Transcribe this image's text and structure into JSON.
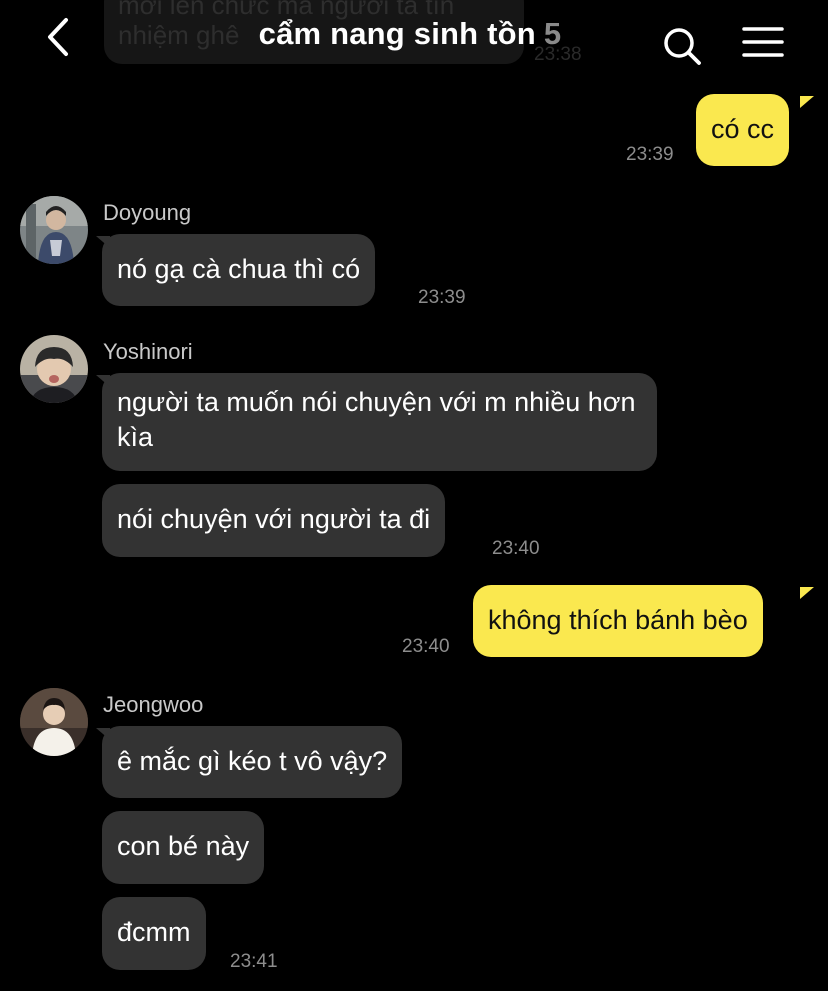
{
  "header": {
    "title": "cẩm nang sinh tồn",
    "member_count": "5",
    "ghost_message": "mới lên chức mà người ta tín nhiệm ghê",
    "ghost_time": "23:38"
  },
  "messages": [
    {
      "id": "m1",
      "direction": "outgoing",
      "text": "có cc",
      "time": "23:39"
    },
    {
      "id": "m2",
      "direction": "incoming",
      "sender": "Doyoung",
      "text": "nó gạ cà chua thì có",
      "time": "23:39"
    },
    {
      "id": "m3",
      "direction": "incoming",
      "sender": "Yoshinori",
      "text": "người ta muốn nói chuyện với m nhiều hơn kìa"
    },
    {
      "id": "m4",
      "direction": "incoming",
      "sender": "Yoshinori",
      "text": "nói chuyện với người ta đi",
      "time": "23:40"
    },
    {
      "id": "m5",
      "direction": "outgoing",
      "text": "không thích bánh bèo",
      "time": "23:40"
    },
    {
      "id": "m6",
      "direction": "incoming",
      "sender": "Jeongwoo",
      "text": "ê mắc gì kéo t vô vậy?"
    },
    {
      "id": "m7",
      "direction": "incoming",
      "sender": "Jeongwoo",
      "text": "con bé này"
    },
    {
      "id": "m8",
      "direction": "incoming",
      "sender": "Jeongwoo",
      "text": "đcmm",
      "time": "23:41"
    }
  ],
  "icons": {
    "back": "chevron-left-icon",
    "search": "search-icon",
    "menu": "hamburger-menu-icon"
  },
  "colors": {
    "background": "#000000",
    "outgoing_bubble": "#fae84f",
    "incoming_bubble": "#333333",
    "timestamp": "#8d8d8d",
    "member_count": "#8a8a8a"
  }
}
